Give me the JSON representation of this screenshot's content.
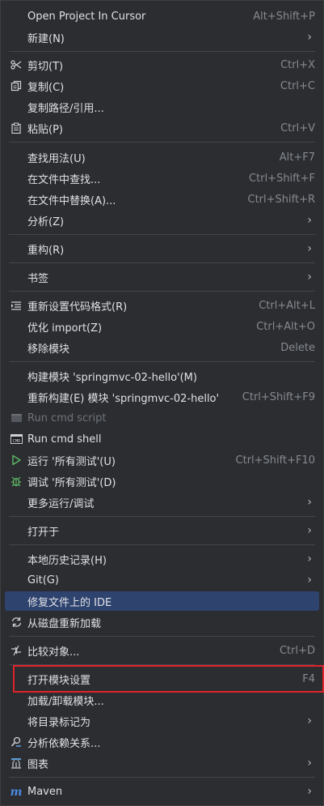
{
  "menu": {
    "open_cursor": {
      "label": "Open Project In Cursor",
      "shortcut": "Alt+Shift+P"
    },
    "new": {
      "label": "新建(N)"
    },
    "cut": {
      "label": "剪切(T)",
      "shortcut": "Ctrl+X",
      "icon": "scissors-icon"
    },
    "copy": {
      "label": "复制(C)",
      "shortcut": "Ctrl+C",
      "icon": "copy-icon"
    },
    "copy_path": {
      "label": "复制路径/引用..."
    },
    "paste": {
      "label": "粘贴(P)",
      "shortcut": "Ctrl+V",
      "icon": "paste-icon"
    },
    "find_usages": {
      "label": "查找用法(U)",
      "shortcut": "Alt+F7"
    },
    "find_in_files": {
      "label": "在文件中查找...",
      "shortcut": "Ctrl+Shift+F"
    },
    "replace_in_files": {
      "label": "在文件中替换(A)...",
      "shortcut": "Ctrl+Shift+R"
    },
    "analyze": {
      "label": "分析(Z)"
    },
    "refactor": {
      "label": "重构(R)"
    },
    "bookmarks": {
      "label": "书签"
    },
    "reformat": {
      "label": "重新设置代码格式(R)",
      "shortcut": "Ctrl+Alt+L",
      "icon": "reformat-icon"
    },
    "optimize_imports": {
      "label": "优化 import(Z)",
      "shortcut": "Ctrl+Alt+O"
    },
    "remove_module": {
      "label": "移除模块",
      "shortcut": "Delete"
    },
    "build_module": {
      "label": "构建模块 'springmvc-02-hello'(M)"
    },
    "rebuild": {
      "label": "重新构建(E) 模块 'springmvc-02-hello'",
      "shortcut": "Ctrl+Shift+F9"
    },
    "run_cmd_script": {
      "label": "Run cmd script"
    },
    "run_cmd_shell": {
      "label": "Run cmd shell"
    },
    "run_all_tests": {
      "label": "运行 '所有测试'(U)",
      "shortcut": "Ctrl+Shift+F10"
    },
    "debug_all_tests": {
      "label": "调试 '所有测试'(D)"
    },
    "more_run": {
      "label": "更多运行/调试"
    },
    "open_in": {
      "label": "打开于"
    },
    "local_history": {
      "label": "本地历史记录(H)"
    },
    "git": {
      "label": "Git(G)"
    },
    "fix_ide": {
      "label": "修复文件上的 IDE"
    },
    "reload": {
      "label": "从磁盘重新加载"
    },
    "compare": {
      "label": "比较对象...",
      "shortcut": "Ctrl+D"
    },
    "module_settings": {
      "label": "打开模块设置",
      "shortcut": "F4"
    },
    "load_unload": {
      "label": "加载/卸载模块..."
    },
    "mark_dir": {
      "label": "将目录标记为"
    },
    "analyze_deps": {
      "label": "分析依赖关系..."
    },
    "diagrams": {
      "label": "图表"
    },
    "maven": {
      "label": "Maven"
    }
  },
  "colors": {
    "selected_bg": "#2e436e",
    "annotation": "#e0232b",
    "accent_green": "#5fb865"
  }
}
